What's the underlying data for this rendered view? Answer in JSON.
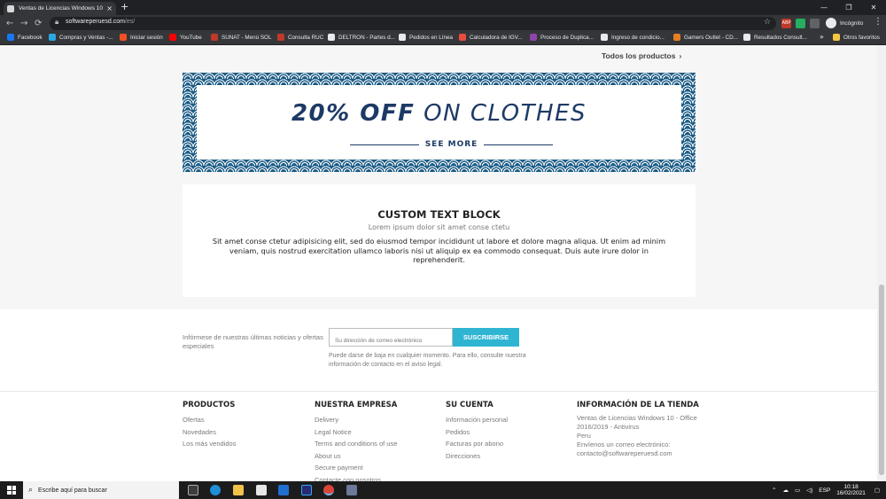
{
  "browser": {
    "tab_title": "Ventas de Licencias Windows 10",
    "tab_close": "×",
    "new_tab": "+",
    "url_domain": "softwareperuesd.com",
    "url_path": "/es/",
    "profile_label": "Incógnito",
    "bookmarks": [
      {
        "label": "Facebook",
        "color": "#1877f2"
      },
      {
        "label": "Compras y Ventas -...",
        "color": "#2aa8e0"
      },
      {
        "label": "Iniciar sesión",
        "color": "#f25022"
      },
      {
        "label": "YouTube",
        "color": "#ff0000"
      },
      {
        "label": "SUNAT - Menú SOL",
        "color": "#c0392b"
      },
      {
        "label": "Consulta RUC",
        "color": "#c0392b"
      },
      {
        "label": "DELTRON - Partes d...",
        "color": "#e8eaed"
      },
      {
        "label": "Pedidos en Línea",
        "color": "#e8eaed"
      },
      {
        "label": "Calculadora de IGV...",
        "color": "#e74c3c"
      },
      {
        "label": "Proceso de Duplica...",
        "color": "#8e44ad"
      },
      {
        "label": "Ingreso de condicio...",
        "color": "#e8eaed"
      },
      {
        "label": "Gamers Outlet - CD...",
        "color": "#e67e22"
      },
      {
        "label": "Resultados Consult...",
        "color": "#e8eaed"
      }
    ],
    "more_bookmarks": "»",
    "other_bookmarks": "Otros favoritos"
  },
  "page": {
    "all_products_link": "Todos los productos",
    "all_products_chevron": "›",
    "banner": {
      "strong": "20% OFF",
      "thin": "ON CLOTHES",
      "cta": "SEE MORE",
      "accent": "#1d3a66"
    },
    "custom_block": {
      "title": "CUSTOM TEXT BLOCK",
      "subtitle": "Lorem ipsum dolor sit amet conse ctetu",
      "body": "Sit amet conse ctetur adipisicing elit, sed do eiusmod tempor incididunt ut labore et dolore magna aliqua. Ut enim ad minim veniam, quis nostrud exercitation ullamco laboris nisi ut aliquip ex ea commodo consequat. Duis aute irure dolor in reprehenderit."
    },
    "newsletter": {
      "label": "Infórmese de nuestras últimas noticias y ofertas especiales",
      "placeholder": "Su dirección de correo electrónico",
      "button": "SUSCRIBIRSE",
      "note": "Puede darse de baja en cualquier momento. Para ello, consulte nuestra información de contacto en el aviso legal.",
      "button_color": "#2fb5d2"
    },
    "footer": {
      "products": {
        "title": "PRODUCTOS",
        "links": [
          "Ofertas",
          "Novedades",
          "Los más vendidos"
        ]
      },
      "company": {
        "title": "NUESTRA EMPRESA",
        "links": [
          "Delivery",
          "Legal Notice",
          "Terms and conditions of use",
          "About us",
          "Secure payment",
          "Contacte con nosotros"
        ]
      },
      "account": {
        "title": "SU CUENTA",
        "links": [
          "Información personal",
          "Pedidos",
          "Facturas por abono",
          "Direcciones"
        ]
      },
      "store": {
        "title": "INFORMACIÓN DE LA TIENDA",
        "name": "Ventas de Licencias Windows 10 - Office 2016/2019 - Antivirus",
        "country": "Peru",
        "email_label": "Envíenos un correo electrónico:",
        "email": "contacto@softwareperuesd.com"
      }
    }
  },
  "taskbar": {
    "search_text": "Escribe aquí para buscar",
    "language": "ESP",
    "time": "10:18",
    "date": "16/02/2021"
  }
}
